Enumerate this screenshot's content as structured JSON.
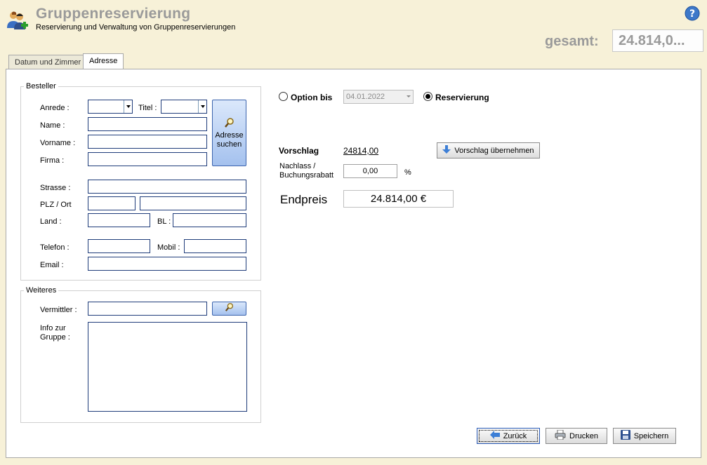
{
  "header": {
    "title": "Gruppenreservierung",
    "subtitle": "Reservierung und Verwaltung von Gruppenreservierungen",
    "total_label": "gesamt:",
    "total_value": "24.814,0..."
  },
  "tabs": [
    {
      "label": "Datum und Zimmer",
      "active": false
    },
    {
      "label": "Adresse",
      "active": true
    }
  ],
  "besteller": {
    "title": "Besteller",
    "anrede_label": "Anrede :",
    "anrede_value": "",
    "titel_label": "Titel :",
    "titel_value": "",
    "name_label": "Name :",
    "vorname_label": "Vorname :",
    "firma_label": "Firma :",
    "search_button": "Adresse suchen",
    "strasse_label": "Strasse :",
    "plz_ort_label": "PLZ / Ort",
    "land_label": "Land :",
    "bl_label": "BL :",
    "telefon_label": "Telefon :",
    "mobil_label": "Mobil :",
    "email_label": "Email :"
  },
  "weiteres": {
    "title": "Weiteres",
    "vermittler_label": "Vermittler :",
    "info_label": "Info zur Gruppe :"
  },
  "options": {
    "option_label": "Option bis",
    "option_date": "04.01.2022",
    "reservierung_label": "Reservierung",
    "selected": "reservierung"
  },
  "pricing": {
    "vorschlag_label": "Vorschlag",
    "vorschlag_value": "24814,00",
    "apply_button": "Vorschlag übernehmen",
    "nachlass_label": "Nachlass / Buchungsrabatt",
    "nachlass_value": "0,00",
    "percent": "%",
    "endpreis_label": "Endpreis",
    "endpreis_value": "24.814,00 €"
  },
  "footer": {
    "back": "Zurück",
    "print": "Drucken",
    "save": "Speichern"
  },
  "colors": {
    "background": "#f7f1d8",
    "input_border": "#1f3c7a",
    "title_gray": "#9a9a9a"
  }
}
